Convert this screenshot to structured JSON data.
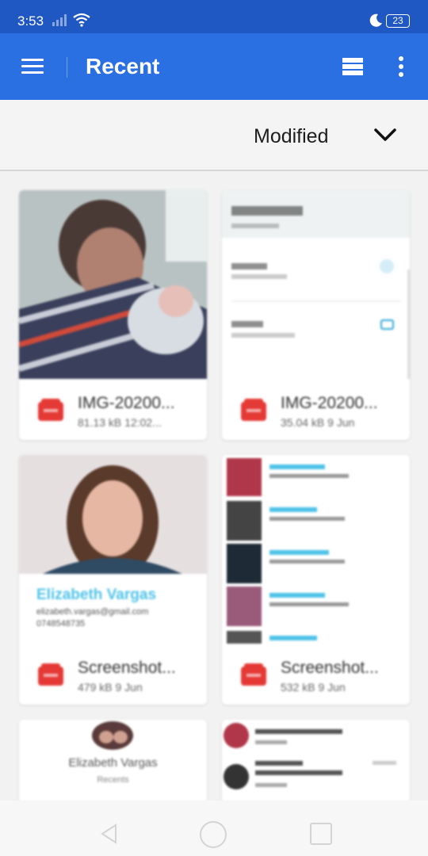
{
  "status_bar": {
    "time": "3:53",
    "battery": "23"
  },
  "app_bar": {
    "title": "Recent"
  },
  "sort": {
    "label": "Modified"
  },
  "files": [
    {
      "name": "IMG-20200...",
      "meta": "81.13 kB 12:02..."
    },
    {
      "name": "IMG-20200...",
      "meta": "35.04 kB 9 Jun"
    },
    {
      "name": "Screenshot...",
      "meta": "479 kB 9 Jun"
    },
    {
      "name": "Screenshot...",
      "meta": "532 kB 9 Jun"
    }
  ],
  "previews": {
    "contact_name": "Elizabeth Vargas",
    "contact_email": "elizabeth.vargas@gmail.com",
    "contact_phone": "0748548735",
    "profile_name": "Elizabeth Vargas",
    "profile_sub": "Recents"
  },
  "colors": {
    "status_bar": "#1f57c3",
    "app_bar": "#2a70e2",
    "pdf_red": "#e53935",
    "link": "#4fc3e8"
  }
}
